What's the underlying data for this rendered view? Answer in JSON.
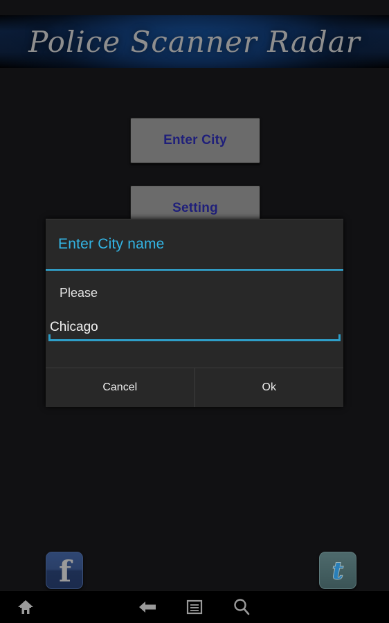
{
  "app": {
    "title": "Police Scanner Radar",
    "background_color": "#111113",
    "accent_color": "#33b5e5"
  },
  "main_menu": {
    "buttons": [
      {
        "label": "Enter City",
        "name": "enter-city-button"
      },
      {
        "label": "Setting",
        "name": "setting-button"
      }
    ]
  },
  "dialog": {
    "title": "Enter City name",
    "message": "Please",
    "input": {
      "value": "Chicago",
      "placeholder": ""
    },
    "buttons": {
      "cancel": "Cancel",
      "ok": "Ok"
    }
  },
  "social": {
    "facebook": {
      "glyph": "f",
      "icon": "facebook-icon",
      "color": "#2a3f68"
    },
    "twitter": {
      "glyph": "t",
      "icon": "twitter-icon",
      "color": "#445f61"
    }
  },
  "navbar": {
    "items": [
      {
        "icon": "home-icon"
      },
      {
        "icon": "back-icon"
      },
      {
        "icon": "menu-icon"
      },
      {
        "icon": "search-icon"
      }
    ],
    "icon_color": "#9a9a9a"
  }
}
